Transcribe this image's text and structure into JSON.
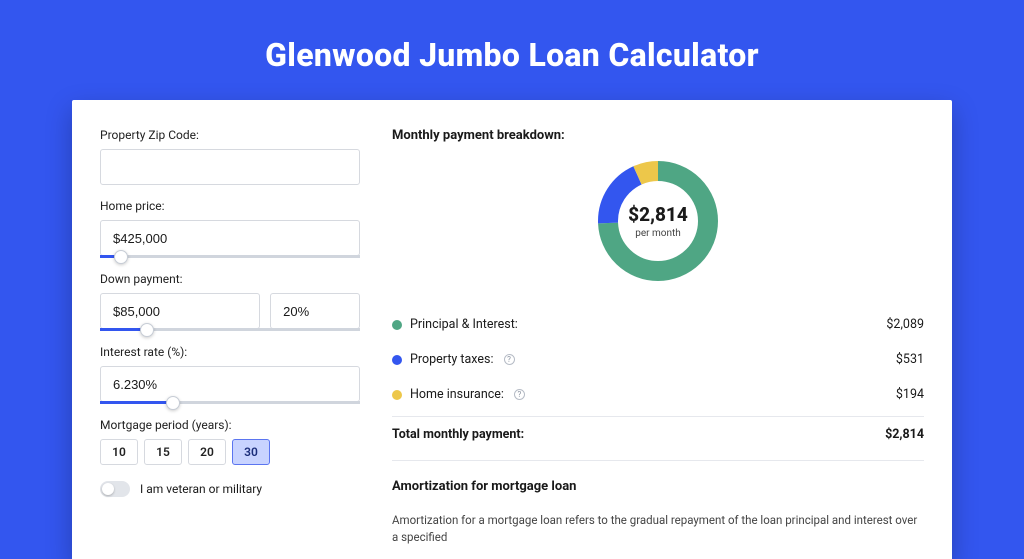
{
  "colors": {
    "accent": "#3356ef",
    "green": "#4fa684",
    "yellow": "#edc74a"
  },
  "title": "Glenwood Jumbo Loan Calculator",
  "form": {
    "zip": {
      "label": "Property Zip Code:",
      "value": ""
    },
    "price": {
      "label": "Home price:",
      "value": "$425,000",
      "slider_pct": 8
    },
    "down": {
      "label": "Down payment:",
      "value": "$85,000",
      "pct": "20%",
      "slider_pct": 18
    },
    "rate": {
      "label": "Interest rate (%):",
      "value": "6.230%",
      "slider_pct": 28
    },
    "period": {
      "label": "Mortgage period (years):",
      "options": [
        "10",
        "15",
        "20",
        "30"
      ],
      "selected": "30"
    },
    "veteran": {
      "label": "I am veteran or military",
      "on": false
    }
  },
  "breakdown": {
    "title": "Monthly payment breakdown:",
    "center_amount": "$2,814",
    "center_sub": "per month",
    "items": [
      {
        "label": "Principal & Interest:",
        "value": "$2,089",
        "info": false
      },
      {
        "label": "Property taxes:",
        "value": "$531",
        "info": true
      },
      {
        "label": "Home insurance:",
        "value": "$194",
        "info": true
      }
    ],
    "total_label": "Total monthly payment:",
    "total_value": "$2,814"
  },
  "amortization": {
    "title": "Amortization for mortgage loan",
    "body": "Amortization for a mortgage loan refers to the gradual repayment of the loan principal and interest over a specified"
  },
  "chart_data": {
    "type": "pie",
    "title": "Monthly payment breakdown",
    "series": [
      {
        "name": "Principal & Interest",
        "value": 2089,
        "color": "#4fa684"
      },
      {
        "name": "Property taxes",
        "value": 531,
        "color": "#3356ef"
      },
      {
        "name": "Home insurance",
        "value": 194,
        "color": "#edc74a"
      }
    ],
    "total": 2814,
    "center_label": "$2,814 per month"
  }
}
